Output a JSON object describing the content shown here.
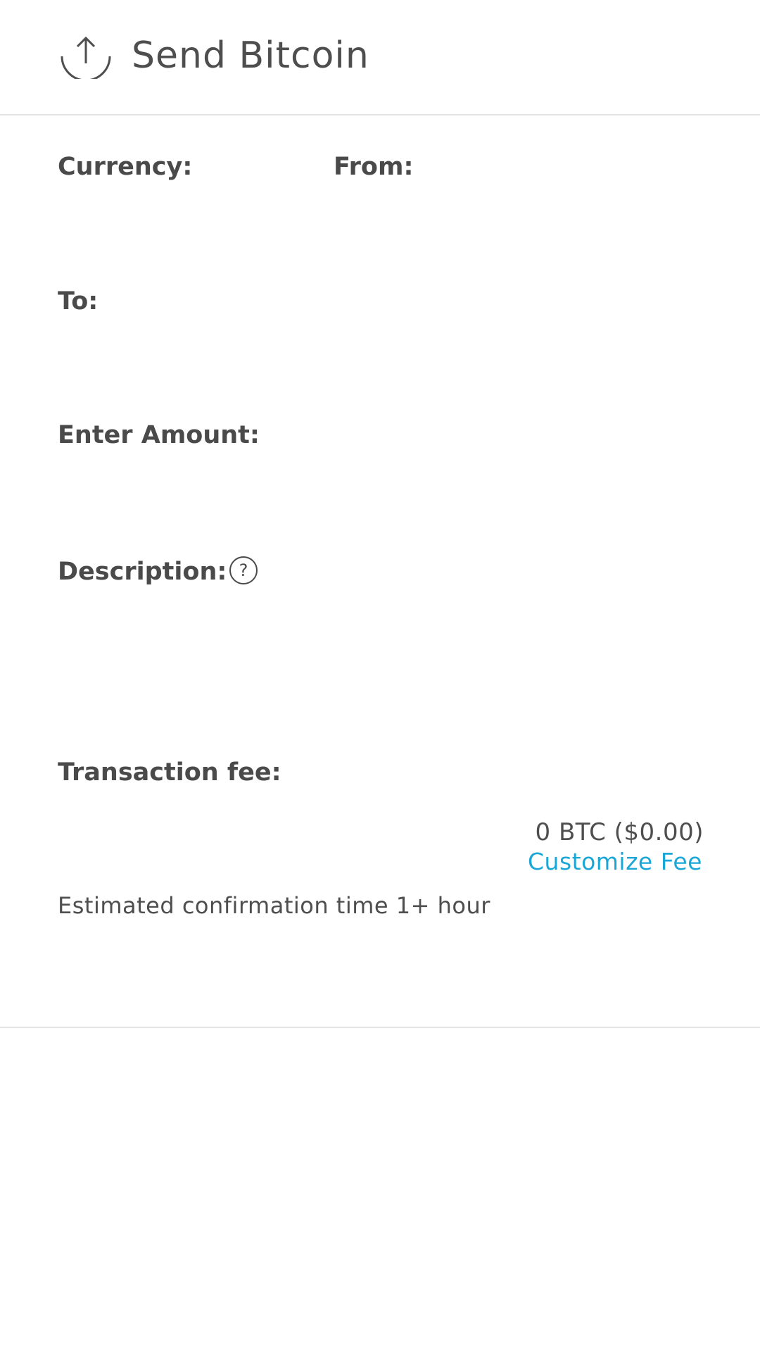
{
  "header": {
    "title": "Send Bitcoin",
    "icon": "upload-icon"
  },
  "form": {
    "currency_label": "Currency:",
    "from_label": "From:",
    "to_label": "To:",
    "amount_label": "Enter Amount:",
    "description_label": "Description:",
    "description_help_icon": "question-circle-icon",
    "fee_label": "Transaction fee:",
    "fee_value": "0 BTC ($0.00)",
    "customize_fee_label": "Customize Fee",
    "estimate_text": "Estimated confirmation time 1+ hour"
  },
  "colors": {
    "link": "#1aa7d8",
    "text": "#4a4a4a",
    "divider": "#e4e4e4"
  }
}
